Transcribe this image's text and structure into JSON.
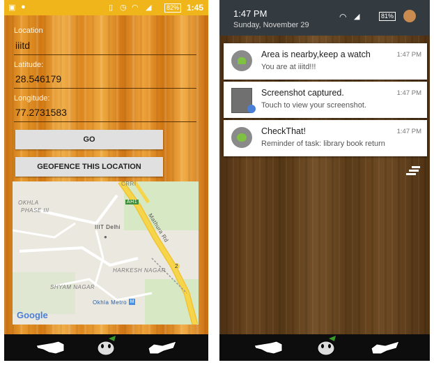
{
  "left_screen": {
    "status_bar": {
      "time": "1:45",
      "battery": "82%"
    },
    "form": {
      "location_label": "Location",
      "location_value": "iiitd",
      "latitude_label": "Latitude:",
      "latitude_value": "28.546179",
      "longitude_label": "Longitude:",
      "longitude_value": "77.2731583"
    },
    "buttons": {
      "go": "GO",
      "geofence": "GEOFENCE THIS LOCATION"
    },
    "map": {
      "labels": {
        "okhla": "OKHLA",
        "phase": "PHASE III",
        "crri": "CRRI",
        "ah1": "AH1",
        "mathura": "Mathura Rd",
        "iiit": "IIIT Delhi",
        "harkesh": "HARKESH NAGAR",
        "shyam": "SHYAM NAGAR",
        "metro": "Okhla Metro",
        "route": "2"
      },
      "logo": "Google"
    }
  },
  "right_screen": {
    "header": {
      "time": "1:47 PM",
      "date": "Sunday, November 29",
      "battery": "81%"
    },
    "notifications": [
      {
        "title": "Area is nearby,keep a watch",
        "text": "You are at iiitd!!!",
        "time": "1:47 PM",
        "icon": "android-app-icon"
      },
      {
        "title": "Screenshot captured.",
        "text": "Touch to view your screenshot.",
        "time": "1:47 PM",
        "icon": "screenshot-thumbnail-icon"
      },
      {
        "title": "CheckThat!",
        "text": "Reminder of task: library book return",
        "time": "1:47 PM",
        "icon": "app-logo-icon"
      }
    ],
    "clear_all_icon": "clear-all-icon"
  },
  "bottom_nav": {
    "icons": [
      "back-hand-icon",
      "home-goofy-icon",
      "recents-hand-icon"
    ]
  },
  "colors": {
    "status_bar": "#f0b51a",
    "notif_header": "#333a40",
    "map_road": "#f7d54a",
    "accent_metro": "#4a90e2"
  }
}
